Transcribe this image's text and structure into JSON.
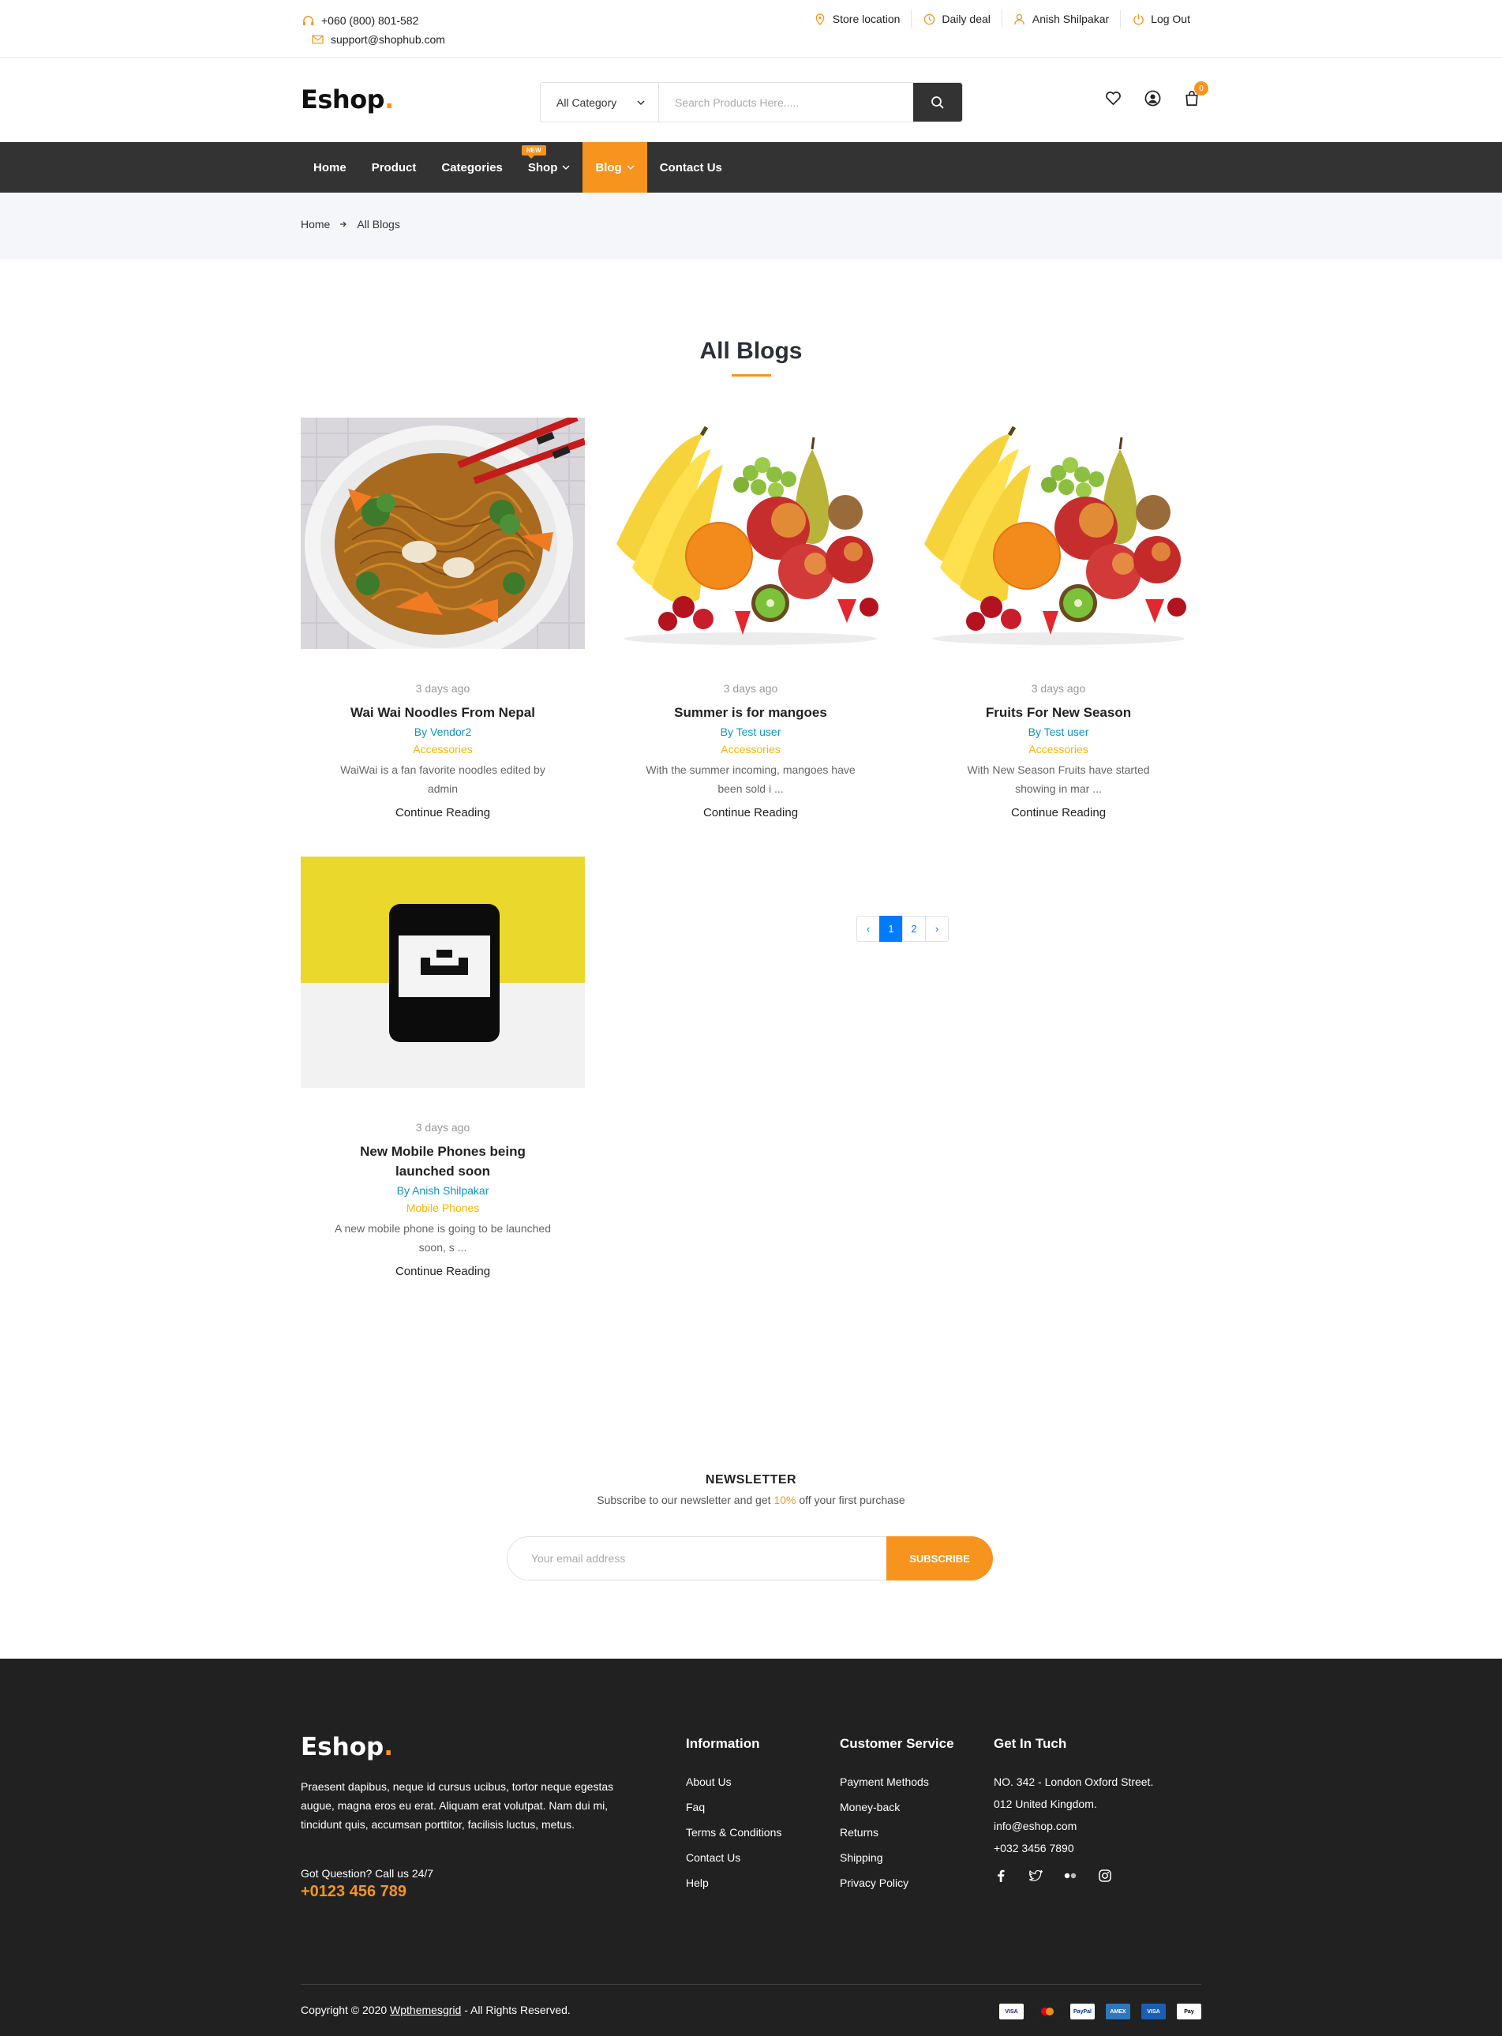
{
  "topbar": {
    "phone": "+060 (800) 801-582",
    "email": "support@shophub.com",
    "links": [
      {
        "label": "Store location",
        "icon": "location-pin-icon"
      },
      {
        "label": "Daily deal",
        "icon": "clock-icon"
      },
      {
        "label": "Anish Shilpakar",
        "icon": "user-icon"
      },
      {
        "label": "Log Out",
        "icon": "power-icon"
      }
    ]
  },
  "header": {
    "logo": "Eshop",
    "logo_dot": ".",
    "search": {
      "category": "All Category",
      "placeholder": "Search Products Here....."
    },
    "cart_count": "0"
  },
  "nav": {
    "items": [
      {
        "label": "Home"
      },
      {
        "label": "Product"
      },
      {
        "label": "Categories"
      },
      {
        "label": "Shop",
        "badge": "NEW"
      },
      {
        "label": "Blog",
        "active": true
      },
      {
        "label": "Contact Us"
      }
    ]
  },
  "breadcrumb": {
    "home": "Home",
    "current": "All Blogs"
  },
  "page": {
    "title": "All Blogs"
  },
  "posts": [
    {
      "date": "3 days ago",
      "title": "Wai Wai Noodles From Nepal",
      "author": "By Vendor2",
      "category": "Accessories",
      "excerpt": "WaiWai is a fan favorite noodles edited by admin",
      "more": "Continue Reading",
      "image": "noodles"
    },
    {
      "date": "3 days ago",
      "title": "Summer is for mangoes",
      "author": "By Test user",
      "category": "Accessories",
      "excerpt": "With the summer incoming, mangoes have been sold i ...",
      "more": "Continue Reading",
      "image": "fruits"
    },
    {
      "date": "3 days ago",
      "title": "Fruits For New Season",
      "author": "By Test user",
      "category": "Accessories",
      "excerpt": "With New Season Fruits have started showing in mar ...",
      "more": "Continue Reading",
      "image": "fruits"
    },
    {
      "date": "3 days ago",
      "title": "New Mobile Phones being launched soon",
      "author": "By Anish Shilpakar",
      "category": "Mobile Phones",
      "excerpt": "A new mobile phone is going to be launched soon, s ...",
      "more": "Continue Reading",
      "image": "phone"
    }
  ],
  "pagination": {
    "prev": "‹",
    "pages": [
      "1",
      "2"
    ],
    "current": "1",
    "next": "›"
  },
  "newsletter": {
    "title": "NEWSLETTER",
    "text_before": "Subscribe to our newsletter and get ",
    "highlight": "10%",
    "text_after": " off your first purchase",
    "placeholder": "Your email address",
    "button": "SUBSCRIBE"
  },
  "footer": {
    "logo": "Eshop",
    "logo_dot": ".",
    "about": "Praesent dapibus, neque id cursus ucibus, tortor neque egestas augue, magna eros eu erat. Aliquam erat volutpat. Nam dui mi, tincidunt quis, accumsan porttitor, facilisis luctus, metus.",
    "question": "Got Question? Call us 24/7",
    "phone": "+0123 456 789",
    "information": {
      "title": "Information",
      "links": [
        "About Us",
        "Faq",
        "Terms & Conditions",
        "Contact Us",
        "Help"
      ]
    },
    "customer_service": {
      "title": "Customer Service",
      "links": [
        "Payment Methods",
        "Money-back",
        "Returns",
        "Shipping",
        "Privacy Policy"
      ]
    },
    "contact": {
      "title": "Get In Tuch",
      "lines": [
        "NO. 342 - London Oxford Street.",
        "012 United Kingdom.",
        "info@eshop.com",
        "+032 3456 7890"
      ]
    },
    "socials": [
      "facebook-icon",
      "twitter-icon",
      "flickr-icon",
      "instagram-icon"
    ],
    "copyright_before": "Copyright © 2020 ",
    "copyright_link": "Wpthemesgrid",
    "copyright_after": " - All Rights Reserved.",
    "payments": [
      {
        "label": "VISA",
        "color": "#1a1f71"
      },
      {
        "label": "MC",
        "color": "#eb001b"
      },
      {
        "label": "PayPal",
        "color": "#003087"
      },
      {
        "label": "AMEX",
        "color": "#2e77bc"
      },
      {
        "label": "VISA",
        "color": "#1a1f71"
      },
      {
        "label": "Pay",
        "color": "#000000"
      }
    ]
  },
  "colors": {
    "accent": "#f7941d",
    "nav_bg": "#333333",
    "footer_bg": "#212121",
    "author": "#0d94c4",
    "category": "#f7b500",
    "pagination_active": "#007bff"
  }
}
